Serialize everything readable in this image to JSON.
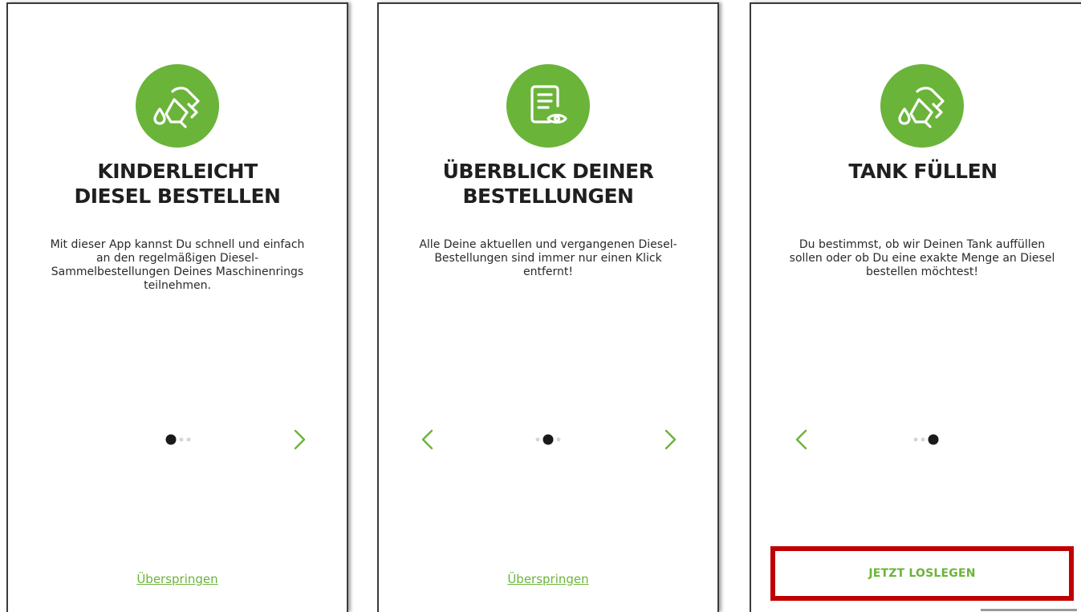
{
  "screens": [
    {
      "icon": "fuel-nozzle-icon",
      "title_lines": [
        "KINDERLEICHT",
        "DIESEL BESTELLEN"
      ],
      "body_lines": [
        "Mit dieser App kannst Du schnell und einfach",
        "an den regelmäßigen Diesel-",
        "Sammelbestellungen Deines Maschinenrings",
        "teilnehmen."
      ],
      "page_index": 1,
      "page_count": 3,
      "skip_label": "Überspringen"
    },
    {
      "icon": "document-view-icon",
      "title_lines": [
        "ÜBERBLICK DEINER",
        "BESTELLUNGEN"
      ],
      "body_lines": [
        "Alle Deine aktuellen und vergangenen Diesel-",
        "Bestellungen sind immer nur einen Klick",
        "entfernt!"
      ],
      "page_index": 2,
      "page_count": 3,
      "skip_label": "Überspringen"
    },
    {
      "icon": "fuel-nozzle-icon",
      "title_lines": [
        "TANK FÜLLEN"
      ],
      "body_lines": [
        "Du bestimmst, ob wir Deinen Tank auffüllen",
        "sollen oder ob Du eine exakte Menge an Diesel",
        "bestellen möchtest!"
      ],
      "page_index": 3,
      "page_count": 3,
      "start_label": "JETZT LOSLEGEN"
    }
  ],
  "colors": {
    "accent_green": "#6bb43a",
    "highlight_red": "#c00000",
    "title_text": "#1f1f1f",
    "dot_active": "#1a1a1a",
    "dot_inactive": "#d6d6d6"
  }
}
